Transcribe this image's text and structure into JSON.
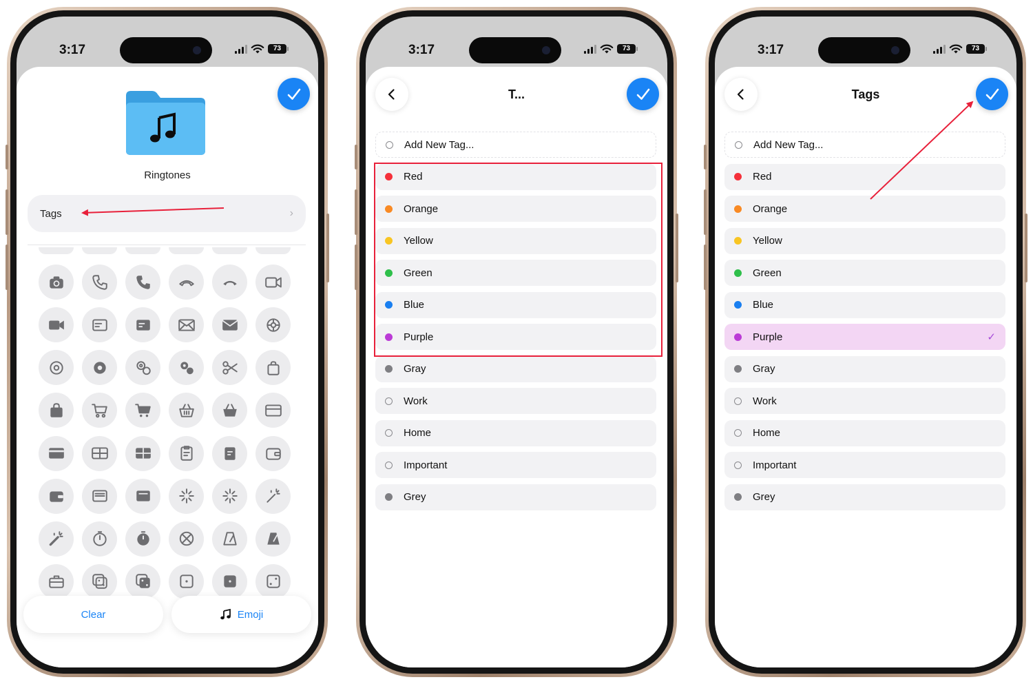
{
  "colors": {
    "accent_blue": "#1a84f5",
    "annotation_red": "#e8203a",
    "selected_row_bg": "#f3d6f4",
    "selected_check": "#a64bd8"
  },
  "status_bar": {
    "time": "3:17",
    "battery": "73"
  },
  "phone1": {
    "folder_icon": "music-folder-icon",
    "folder_name": "Ringtones",
    "tags_label": "Tags",
    "clear_label": "Clear",
    "emoji_label": "Emoji",
    "grid_icons": [
      "camera-icon",
      "phone-icon",
      "phone-fill-icon",
      "phone-down-icon",
      "phone-down-fill-icon",
      "video-icon",
      "video-fill-icon",
      "menucard-icon",
      "menucard-fill-icon",
      "envelope-icon",
      "envelope-fill-icon",
      "gear-badge-icon",
      "gear-icon",
      "gear-fill-icon",
      "gears-icon",
      "gears-fill-icon",
      "scissors-icon",
      "bag-icon",
      "bag-fill-icon",
      "cart-icon",
      "cart-fill-icon",
      "basket-icon",
      "basket-fill-icon",
      "creditcard-icon",
      "creditcard-fill-icon",
      "giftcard-icon",
      "giftcard-fill-icon",
      "clipboard-icon",
      "clipboard-fill-icon",
      "wallet-icon",
      "wallet-fill-icon",
      "wallet-pass-icon",
      "wallet-pass-fill-icon",
      "sparkle-icon",
      "sparkle-alt-icon",
      "magic-wand-icon",
      "magic-wand-fill-icon",
      "timer-icon",
      "timer-fill-icon",
      "gauge-icon",
      "metronome-icon",
      "metronome-fill-icon",
      "toolbox-icon",
      "dice-icon",
      "dice-fill-icon",
      "die-face-1-icon",
      "die-face-1-fill-icon",
      "die-face-2-icon"
    ]
  },
  "phone2": {
    "title": "T...",
    "add_tag_label": "Add New Tag...",
    "tags": [
      {
        "label": "Red",
        "color": "#f5303a",
        "hollow": false,
        "selected": false
      },
      {
        "label": "Orange",
        "color": "#f98a24",
        "hollow": false,
        "selected": false
      },
      {
        "label": "Yellow",
        "color": "#f8c523",
        "hollow": false,
        "selected": false
      },
      {
        "label": "Green",
        "color": "#2fbf4b",
        "hollow": false,
        "selected": false
      },
      {
        "label": "Blue",
        "color": "#1a7ff0",
        "hollow": false,
        "selected": false
      },
      {
        "label": "Purple",
        "color": "#bb3bd6",
        "hollow": false,
        "selected": false
      },
      {
        "label": "Gray",
        "color": "#7f7f83",
        "hollow": false,
        "selected": false
      },
      {
        "label": "Work",
        "color": "",
        "hollow": true,
        "selected": false
      },
      {
        "label": "Home",
        "color": "",
        "hollow": true,
        "selected": false
      },
      {
        "label": "Important",
        "color": "",
        "hollow": true,
        "selected": false
      },
      {
        "label": "Grey",
        "color": "#7f7f83",
        "hollow": false,
        "selected": false
      }
    ]
  },
  "phone3": {
    "title": "Tags",
    "add_tag_label": "Add New Tag...",
    "tags": [
      {
        "label": "Red",
        "color": "#f5303a",
        "hollow": false,
        "selected": false
      },
      {
        "label": "Orange",
        "color": "#f98a24",
        "hollow": false,
        "selected": false
      },
      {
        "label": "Yellow",
        "color": "#f8c523",
        "hollow": false,
        "selected": false
      },
      {
        "label": "Green",
        "color": "#2fbf4b",
        "hollow": false,
        "selected": false
      },
      {
        "label": "Blue",
        "color": "#1a7ff0",
        "hollow": false,
        "selected": false
      },
      {
        "label": "Purple",
        "color": "#bb3bd6",
        "hollow": false,
        "selected": true
      },
      {
        "label": "Gray",
        "color": "#7f7f83",
        "hollow": false,
        "selected": false
      },
      {
        "label": "Work",
        "color": "",
        "hollow": true,
        "selected": false
      },
      {
        "label": "Home",
        "color": "",
        "hollow": true,
        "selected": false
      },
      {
        "label": "Important",
        "color": "",
        "hollow": true,
        "selected": false
      },
      {
        "label": "Grey",
        "color": "#7f7f83",
        "hollow": false,
        "selected": false
      }
    ]
  }
}
